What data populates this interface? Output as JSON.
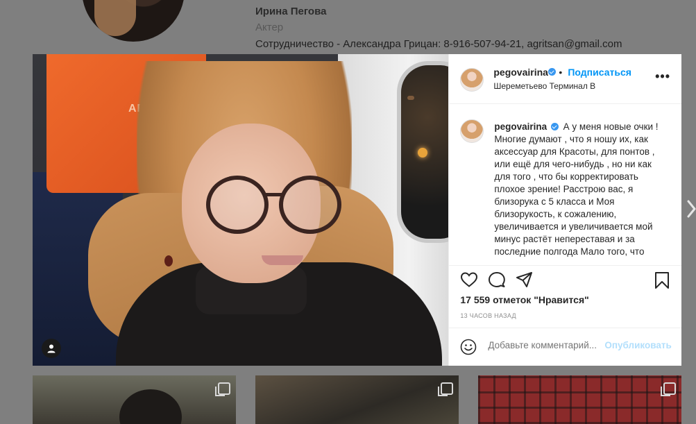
{
  "profile": {
    "name": "Ирина Пегова",
    "role": "Актер",
    "bio": "Сотрудничество - Александра Грицан: 8-916-507-94-21, agritsan@gmail.com"
  },
  "post": {
    "photo_overlay_text": "AE",
    "header": {
      "username": "pegovairina",
      "separator": "•",
      "follow_label": "Подписаться",
      "location": "Шереметьево Терминал B",
      "more": "•••"
    },
    "caption": {
      "username": "pegovairina",
      "text": "А у меня новые очки ! Многие думают , что я ношу их, как аксессуар для Красоты, для понтов , или ещё для чего-нибудь , но ни как для того , что бы корректировать плохое зрение! Расстрою вас, я близорука с 5 класса и Моя близорукость, к сожалению, увеличивается и увеличивается мой минус растёт непереставая и за последние полгода Мало того, что"
    },
    "likes": "17 559 отметок \"Нравится\"",
    "time": "13 ЧАСОВ НАЗАД",
    "comment": {
      "placeholder": "Добавьте комментарий...",
      "publish_label": "Опубликовать"
    }
  },
  "colors": {
    "accent": "#0095f6",
    "publish_disabled": "#b2dffc",
    "verified": "#3897f0",
    "backdrop": "#7f7f7f"
  },
  "icons": [
    "heart-icon",
    "comment-icon",
    "share-icon",
    "bookmark-icon",
    "emoji-icon",
    "user-tag-icon",
    "next-arrow-icon",
    "multi-photo-icon"
  ]
}
